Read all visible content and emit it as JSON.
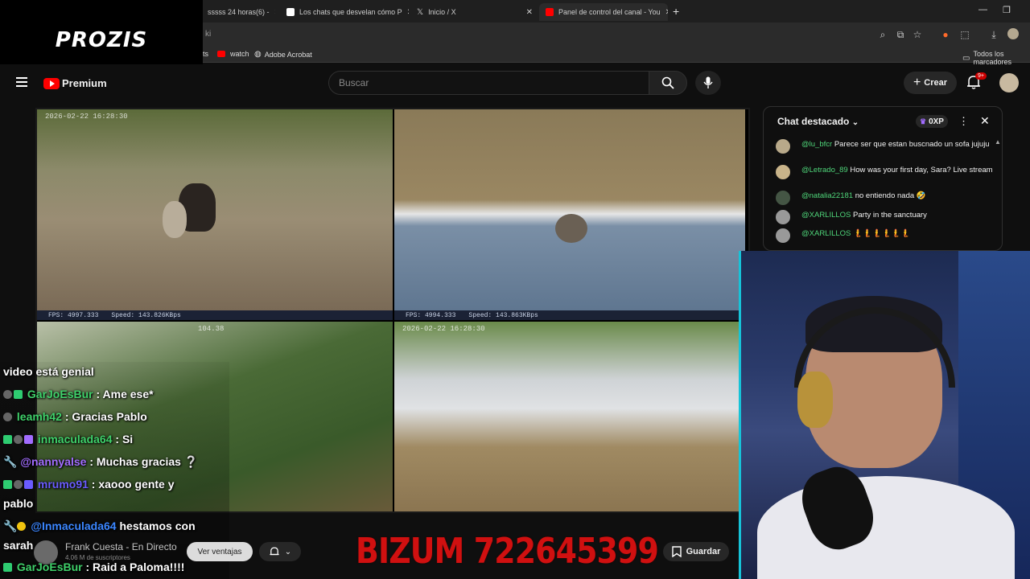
{
  "browser": {
    "tabs": [
      {
        "label": "sssss 24 horas(6) - ",
        "favicon_color": "#d92a2a"
      },
      {
        "label": "Los chats que desvelan cómo P",
        "favicon_color": "#ffffff"
      },
      {
        "label": "Inicio / X",
        "favicon_color": "#000000"
      },
      {
        "label": "Panel de control del canal - You",
        "favicon_color": "#ff0000"
      }
    ],
    "url_fragment": "ki",
    "bookmarks": [
      {
        "label": "ts"
      },
      {
        "label": "watch"
      },
      {
        "label": "Adobe Acrobat"
      }
    ],
    "all_bookmarks_label": "Todos los marcadores"
  },
  "overlay": {
    "sponsor_logo": "PROZIS",
    "donation_banner": "BIZUM 722645399"
  },
  "youtube": {
    "logo_label": "Premium",
    "search_placeholder": "Buscar",
    "create_label": "Crear",
    "notification_badge": "9+",
    "channel": {
      "name": "Frank Cuesta - En Directo",
      "subscribers": "4.06 M de suscriptores",
      "perks_button": "Ver ventajas",
      "save_button": "Guardar"
    }
  },
  "video": {
    "cams": [
      {
        "timestamp": "2026-02-22 16:28:30"
      },
      {
        "timestamp": ""
      },
      {
        "timestamp": "104.38"
      },
      {
        "timestamp": "2026-02-22 16:28:30"
      }
    ],
    "stats": [
      {
        "fps": "FPS: 4997.333",
        "speed": "Speed: 143.826KBps"
      },
      {
        "fps": "FPS: 4994.333",
        "speed": "Speed: 143.863KBps"
      }
    ]
  },
  "featured_chat": {
    "title": "Chat destacado",
    "xp_label": "0XP",
    "messages": [
      {
        "user": "@lu_bfcr",
        "text": "Parece ser que estan buscnado un sofa jujuju",
        "avatar_color": "#b8a98a"
      },
      {
        "user": "@Letrado_89",
        "text": "How was your first day, Sara? Live stream",
        "avatar_color": "#c9b48a"
      },
      {
        "user": "@natalia22181",
        "text": "no entiendo nada 🤣",
        "avatar_color": "#445544"
      },
      {
        "user": "@XARLILLOS",
        "text": "Party in the sanctuary",
        "avatar_color": "#999999"
      },
      {
        "user": "@XARLILLOS",
        "text": "🧜🧜🧜🧜🧜🧜",
        "avatar_color": "#999999"
      }
    ]
  },
  "stream_chat": [
    {
      "user": "",
      "text": "video está genial",
      "color": ""
    },
    {
      "user": "GarJoEsBur",
      "text": " : Ame ese*",
      "color": "green"
    },
    {
      "user": "leamh42",
      "text": " : Gracias Pablo",
      "color": "green"
    },
    {
      "user": "inmaculada64",
      "text": " : Si",
      "color": "green"
    },
    {
      "user": "@nannyalse",
      "text": " : Muchas gracias ❔",
      "color": "purple"
    },
    {
      "user": "mrumo91",
      "text": " : xaooo gente y",
      "color": "indigo"
    },
    {
      "user": "",
      "text": "pablo",
      "color": ""
    },
    {
      "user": "@Inmaculada64",
      "text": " hestamos con",
      "color": "blue"
    },
    {
      "user": "",
      "text": "sarah",
      "color": ""
    },
    {
      "user": "GarJoEsBur",
      "text": " : Raid a Paloma!!!!",
      "color": "green"
    }
  ]
}
